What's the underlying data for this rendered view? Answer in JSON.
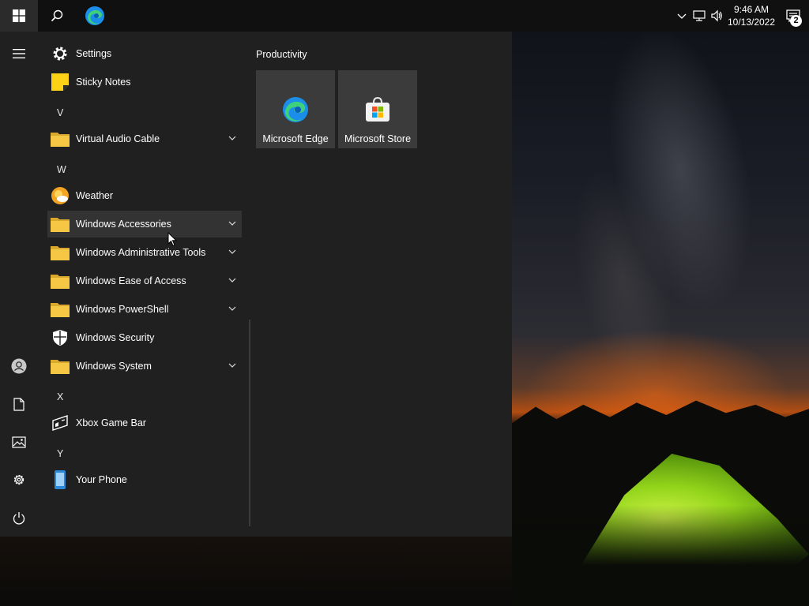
{
  "taskbar": {
    "start_icon": "windows-logo-icon",
    "search_icon": "search-icon",
    "pinned_app_icon": "edge-icon",
    "tray": {
      "overflow_icon": "chevron-up-icon",
      "network_icon": "network-icon",
      "volume_icon": "volume-icon"
    },
    "clock": {
      "time": "9:46 AM",
      "date": "10/13/2022"
    },
    "notifications": {
      "icon": "action-center-icon",
      "count": "2"
    }
  },
  "rail": {
    "items": [
      {
        "name": "menu",
        "icon": "hamburger-icon"
      },
      {
        "name": "account",
        "icon": "user-icon"
      },
      {
        "name": "documents",
        "icon": "document-icon"
      },
      {
        "name": "pictures",
        "icon": "image-icon"
      },
      {
        "name": "settings",
        "icon": "gear-icon"
      },
      {
        "name": "power",
        "icon": "power-icon"
      }
    ]
  },
  "apps": {
    "settings": {
      "label": "Settings",
      "icon": "gear-icon"
    },
    "sticky_notes": {
      "label": "Sticky Notes",
      "icon": "sticky-notes-icon"
    },
    "letter_v": "V",
    "virtual_audio_cable": {
      "label": "Virtual Audio Cable",
      "icon": "folder-icon"
    },
    "letter_w": "W",
    "weather": {
      "label": "Weather",
      "icon": "weather-icon"
    },
    "windows_accessories": {
      "label": "Windows Accessories",
      "icon": "folder-icon"
    },
    "windows_admin_tools": {
      "label": "Windows Administrative Tools",
      "icon": "folder-icon"
    },
    "windows_ease_of_access": {
      "label": "Windows Ease of Access",
      "icon": "folder-icon"
    },
    "windows_powershell": {
      "label": "Windows PowerShell",
      "icon": "folder-icon"
    },
    "windows_security": {
      "label": "Windows Security",
      "icon": "shield-icon"
    },
    "windows_system": {
      "label": "Windows System",
      "icon": "folder-icon"
    },
    "letter_x": "X",
    "xbox_game_bar": {
      "label": "Xbox Game Bar",
      "icon": "xbox-game-bar-icon"
    },
    "letter_y": "Y",
    "your_phone": {
      "label": "Your Phone",
      "icon": "phone-icon"
    }
  },
  "tiles": {
    "group_title": "Productivity",
    "edge": {
      "label": "Microsoft Edge",
      "icon": "edge-icon"
    },
    "store": {
      "label": "Microsoft Store",
      "icon": "store-bag-icon"
    }
  },
  "colors": {
    "taskbar": "#101010",
    "start_menu": "#202020",
    "tile": "#3b3b3b",
    "folder": "#f6c745",
    "hover": "#333333"
  }
}
